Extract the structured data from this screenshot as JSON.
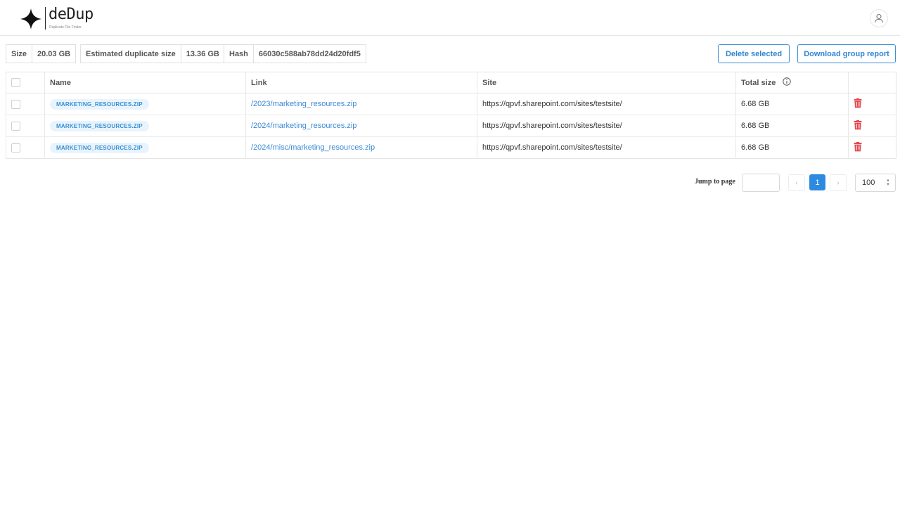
{
  "app": {
    "name": "deDup",
    "tagline": "Duplicate File Finder"
  },
  "summary": {
    "size_label": "Size",
    "size_value": "20.03 GB",
    "dup_label": "Estimated duplicate size",
    "dup_value": "13.36 GB",
    "hash_label": "Hash",
    "hash_value": "66030c588ab78dd24d20fdf5"
  },
  "actions": {
    "delete_label": "Delete selected",
    "report_label": "Download group report"
  },
  "table": {
    "columns": {
      "name": "Name",
      "link": "Link",
      "site": "Site",
      "total_size": "Total size"
    },
    "rows": [
      {
        "name": "MARKETING_RESOURCES.ZIP",
        "link": "/2023/marketing_resources.zip",
        "site": "https://qpvf.sharepoint.com/sites/testsite/",
        "size": "6.68 GB"
      },
      {
        "name": "MARKETING_RESOURCES.ZIP",
        "link": "/2024/marketing_resources.zip",
        "site": "https://qpvf.sharepoint.com/sites/testsite/",
        "size": "6.68 GB"
      },
      {
        "name": "MARKETING_RESOURCES.ZIP",
        "link": "/2024/misc/marketing_resources.zip",
        "site": "https://qpvf.sharepoint.com/sites/testsite/",
        "size": "6.68 GB"
      }
    ]
  },
  "pagination": {
    "jump_label": "Jump to page",
    "jump_value": "",
    "prev_icon": "‹",
    "next_icon": "›",
    "current_page": "1",
    "page_size": "100"
  },
  "colors": {
    "accent": "#2d8ae0",
    "link": "#3b8ad3",
    "tag_bg": "#e8f4fd",
    "danger": "#e5484d"
  },
  "icons": [
    "logo-diamond-icon",
    "user-icon",
    "info-icon",
    "trash-icon",
    "chevron-left-icon",
    "chevron-right-icon",
    "sort-arrows-icon"
  ]
}
